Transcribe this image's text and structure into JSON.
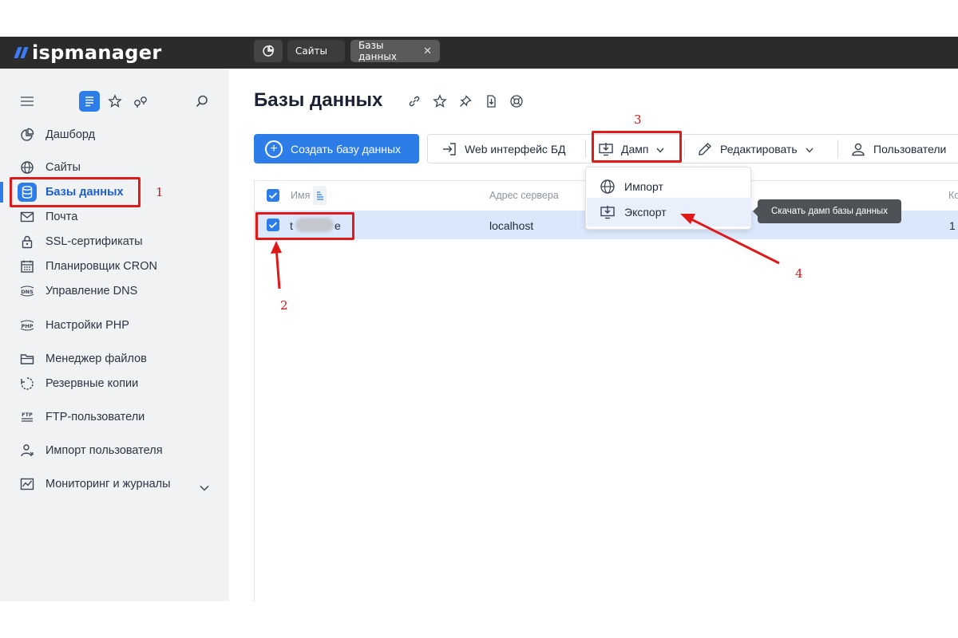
{
  "topbar": {
    "logo_text": "ispmanager",
    "tabs": [
      {
        "label": "Сайты"
      },
      {
        "label": "Базы данных"
      }
    ]
  },
  "sidebar": {
    "items": [
      {
        "label": "Дашборд",
        "icon": "dashboard-icon"
      },
      {
        "label": "Сайты",
        "icon": "globe-icon"
      },
      {
        "label": "Базы данных",
        "icon": "database-icon"
      },
      {
        "label": "Почта",
        "icon": "mail-icon"
      },
      {
        "label": "SSL-сертификаты",
        "icon": "lock-icon"
      },
      {
        "label": "Планировщик CRON",
        "icon": "calendar-icon"
      },
      {
        "label": "Управление DNS",
        "icon": "dns-icon"
      },
      {
        "label": "Настройки PHP",
        "icon": "php-icon"
      },
      {
        "label": "Менеджер файлов",
        "icon": "folder-icon"
      },
      {
        "label": "Резервные копии",
        "icon": "backup-icon"
      },
      {
        "label": "FTP-пользователи",
        "icon": "ftp-icon"
      },
      {
        "label": "Импорт пользователя",
        "icon": "user-import-icon"
      },
      {
        "label": "Мониторинг и журналы",
        "icon": "monitoring-icon"
      }
    ]
  },
  "main": {
    "title": "Базы данных",
    "toolbar": {
      "create_label": "Создать базу данных",
      "web_label": "Web интерфейс БД",
      "dump_label": "Дамп",
      "edit_label": "Редактировать",
      "users_label": "Пользователи"
    },
    "table": {
      "columns": [
        "Имя",
        "Адрес сервера",
        "Ко"
      ],
      "rows": [
        {
          "name_start": "t",
          "name_end": "e",
          "server": "localhost",
          "count": "1"
        }
      ]
    },
    "dropdown": {
      "items": [
        {
          "label": "Импорт"
        },
        {
          "label": "Экспорт"
        }
      ]
    },
    "tooltip": "Скачать дамп базы данных"
  },
  "annotations": {
    "numbers": [
      "1",
      "2",
      "3",
      "4"
    ]
  },
  "colors": {
    "accent": "#2d7de8",
    "annotation": "#e01919",
    "topbar": "#2b2b2b"
  }
}
